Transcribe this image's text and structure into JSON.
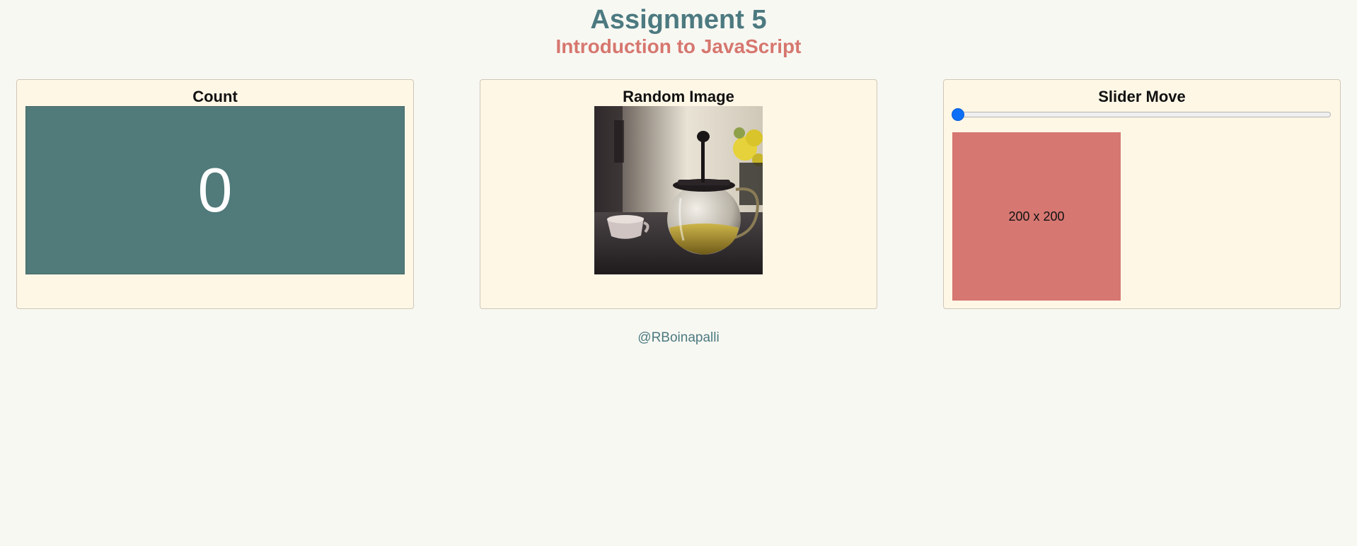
{
  "header": {
    "title": "Assignment 5",
    "subtitle": "Introduction to JavaScript"
  },
  "cards": {
    "count": {
      "title": "Count",
      "value": "0"
    },
    "random_image": {
      "title": "Random Image",
      "image_subject": "teapot-with-tea-and-cup"
    },
    "slider_move": {
      "title": "Slider Move",
      "slider_value": 0,
      "box_label": "200 x 200"
    }
  },
  "footer": {
    "handle": "@RBoinapalli"
  },
  "colors": {
    "title": "#4c7a80",
    "subtitle": "#d6776f",
    "count_box": "#517a7a",
    "resize_box": "#d67772",
    "card_bg": "#fff7e6",
    "slider_thumb": "#0b6ff7"
  }
}
